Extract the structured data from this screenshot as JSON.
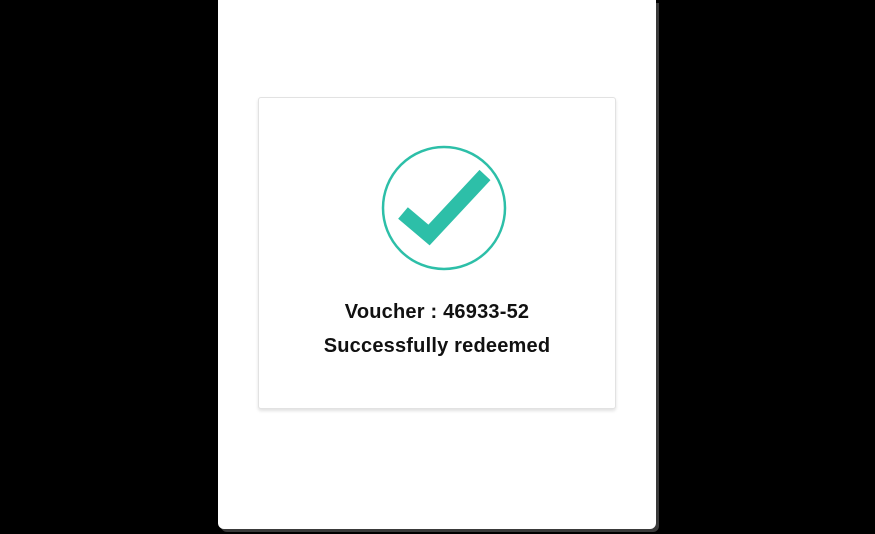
{
  "dialog": {
    "icon": "check-circle-icon",
    "accent_color": "#2dbfa8",
    "voucher_label": "Voucher",
    "voucher_separator": " : ",
    "voucher_code": "46933-52",
    "status_message": "Successfully redeemed"
  }
}
